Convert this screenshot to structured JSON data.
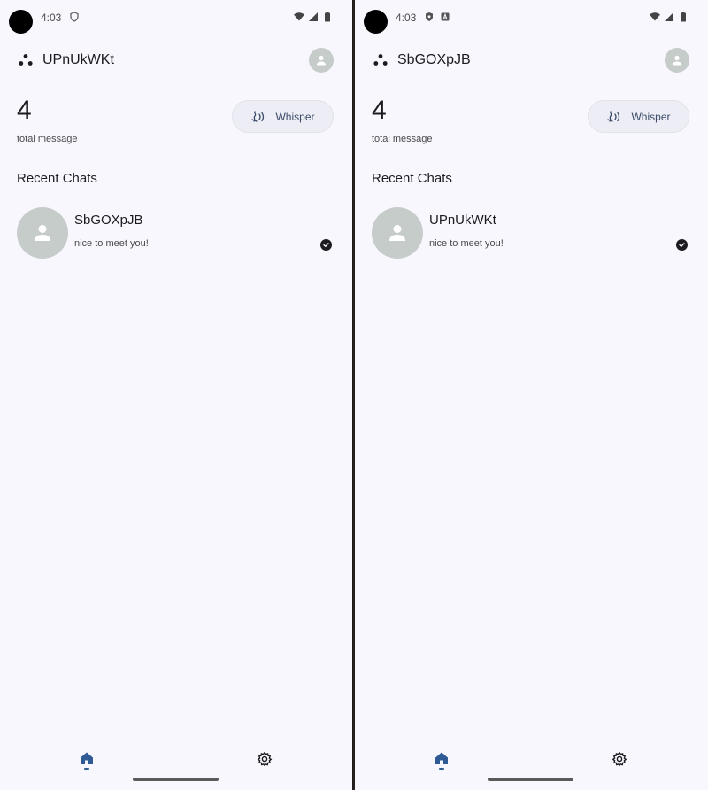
{
  "panes": [
    {
      "status_time": "4:03",
      "app_title": "UPnUkWKt",
      "total_count": "4",
      "total_label": "total message",
      "whisper_label": "Whisper",
      "section_title": "Recent Chats",
      "chat": {
        "name": "SbGOXpJB",
        "preview": "nice to meet you!"
      }
    },
    {
      "status_time": "4:03",
      "app_title": "SbGOXpJB",
      "total_count": "4",
      "total_label": "total message",
      "whisper_label": "Whisper",
      "section_title": "Recent Chats",
      "chat": {
        "name": "UPnUkWKt",
        "preview": "nice to meet you!"
      }
    }
  ],
  "icons": {
    "status_left_pane1": [
      "shield-icon"
    ],
    "status_left_pane2": [
      "shield-filled-icon",
      "a-badge-icon"
    ],
    "status_right": [
      "wifi-icon",
      "signal-icon",
      "battery-icon"
    ],
    "nav": [
      "home-icon",
      "settings-icon"
    ]
  },
  "colors": {
    "background": "#f8f7fe",
    "accent": "#2f5a93",
    "avatar": "#c5ccca",
    "whisper_button": "#edeef5"
  }
}
